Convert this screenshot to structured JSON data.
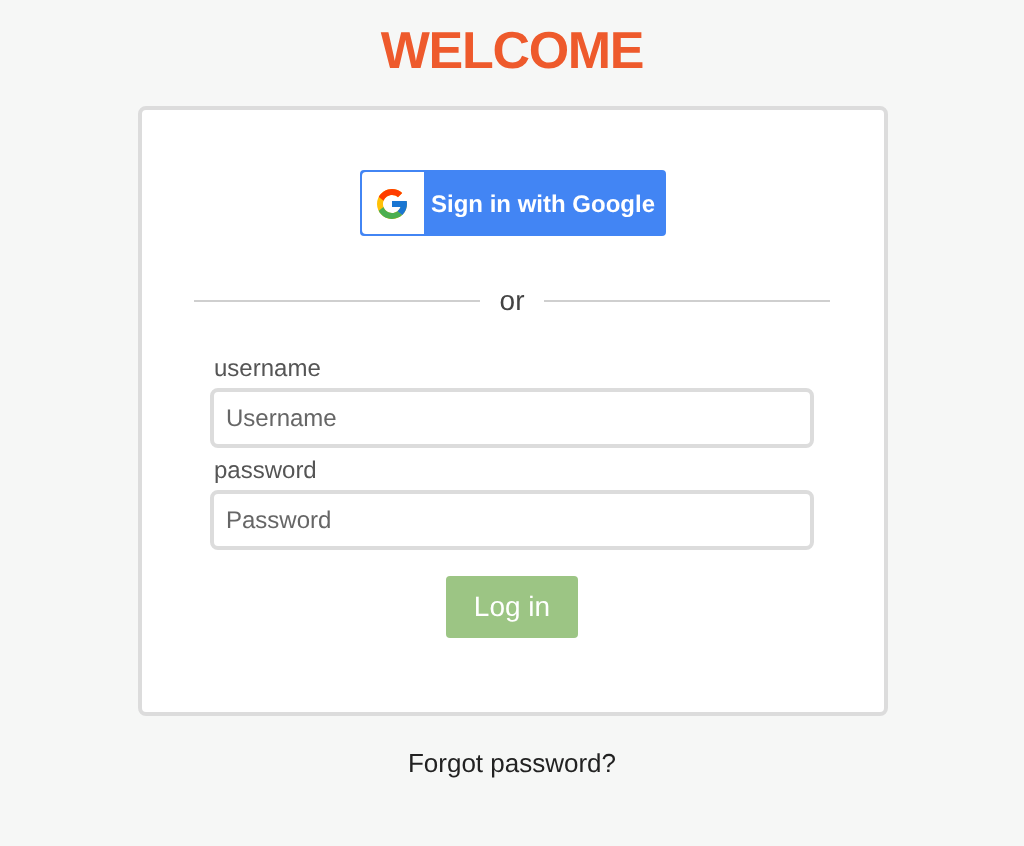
{
  "title": "WELCOME",
  "google_button": {
    "label": "Sign in with Google"
  },
  "divider": {
    "label": "or"
  },
  "fields": [
    {
      "label": "username",
      "placeholder": "Username"
    },
    {
      "label": "password",
      "placeholder": "Password"
    }
  ],
  "login_button": {
    "label": "Log in"
  },
  "forgot_link": {
    "label": "Forgot password?"
  }
}
